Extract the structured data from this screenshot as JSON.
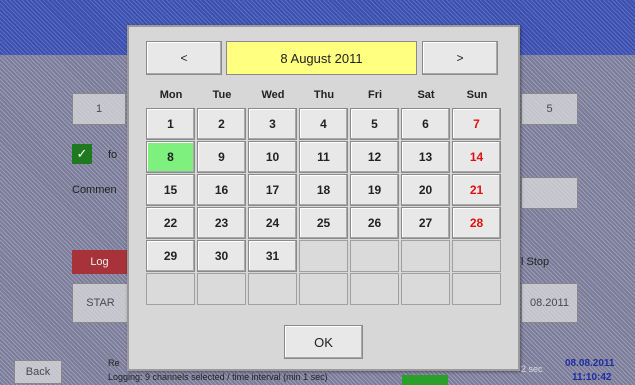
{
  "background": {
    "tab_labels": [
      "1",
      "5"
    ],
    "checkbox_label": "fo",
    "comment_label": "Commen",
    "log_button": "Log",
    "stop_label": "l Stop",
    "start_label": "STAR",
    "date_label": "08.2011",
    "back_button": "Back",
    "status_line_1": "Re",
    "status_line_2": "Logging: 9 channels selected / time interval (min 1 sec)",
    "status_sec": "2 sec",
    "status_date": "08.08.2011",
    "status_time": "11:10:42"
  },
  "calendar": {
    "prev_label": "<",
    "next_label": ">",
    "month_title": "8 August 2011",
    "weekdays": [
      "Mon",
      "Tue",
      "Wed",
      "Thu",
      "Fri",
      "Sat",
      "Sun"
    ],
    "weeks": [
      [
        "1",
        "2",
        "3",
        "4",
        "5",
        "6",
        "7"
      ],
      [
        "8",
        "9",
        "10",
        "11",
        "12",
        "13",
        "14"
      ],
      [
        "15",
        "16",
        "17",
        "18",
        "19",
        "20",
        "21"
      ],
      [
        "22",
        "23",
        "24",
        "25",
        "26",
        "27",
        "28"
      ],
      [
        "29",
        "30",
        "31",
        "",
        "",
        "",
        ""
      ],
      [
        "",
        "",
        "",
        "",
        "",
        "",
        ""
      ]
    ],
    "selected_day": "8",
    "ok_label": "OK"
  },
  "colors": {
    "selected_day": "#7ef07e",
    "weekend_text": "#e01010",
    "month_title_bg": "#ffff80"
  }
}
